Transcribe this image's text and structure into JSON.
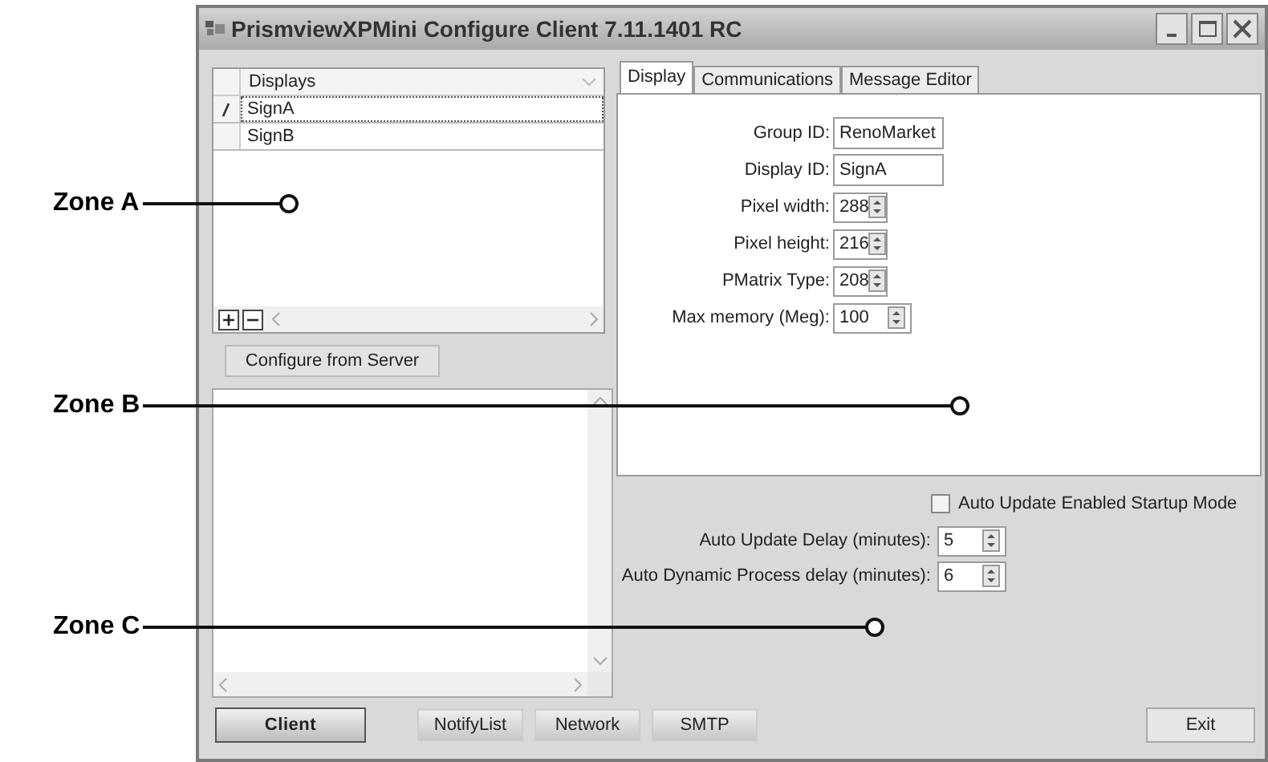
{
  "window": {
    "title": "PrismviewXPMini Configure Client 7.11.1401 RC"
  },
  "displays": {
    "column": "Displays",
    "rows": [
      {
        "name": "SignA",
        "selected": true
      },
      {
        "name": "SignB",
        "selected": false
      }
    ]
  },
  "configure_button": "Configure from Server",
  "tabs": [
    {
      "label": "Display",
      "selected": true
    },
    {
      "label": "Communications",
      "selected": false
    },
    {
      "label": "Message Editor",
      "selected": false
    }
  ],
  "display_fields": [
    {
      "label": "Group ID:",
      "value": "RenoMarket",
      "kind": "text"
    },
    {
      "label": "Display ID:",
      "value": "SignA",
      "kind": "text"
    },
    {
      "label": "Pixel width:",
      "value": "288",
      "kind": "spin"
    },
    {
      "label": "Pixel height:",
      "value": "216",
      "kind": "spin"
    },
    {
      "label": "PMatrix Type:",
      "value": "208",
      "kind": "spin"
    },
    {
      "label": "Max memory (Meg):",
      "value": "100",
      "kind": "spin"
    }
  ],
  "startup_checkbox": {
    "label": "Auto Update Enabled Startup Mode",
    "checked": false
  },
  "delay_fields": [
    {
      "label": "Auto Update Delay (minutes):",
      "value": "5"
    },
    {
      "label": "Auto Dynamic Process delay (minutes):",
      "value": "6"
    }
  ],
  "nav_buttons": [
    {
      "label": "Client",
      "selected": true
    },
    {
      "label": "NotifyList",
      "selected": false
    },
    {
      "label": "Network",
      "selected": false
    },
    {
      "label": "SMTP",
      "selected": false
    }
  ],
  "exit_button": "Exit",
  "callouts": [
    {
      "label": "Zone A"
    },
    {
      "label": "Zone B"
    },
    {
      "label": "Zone C"
    }
  ]
}
